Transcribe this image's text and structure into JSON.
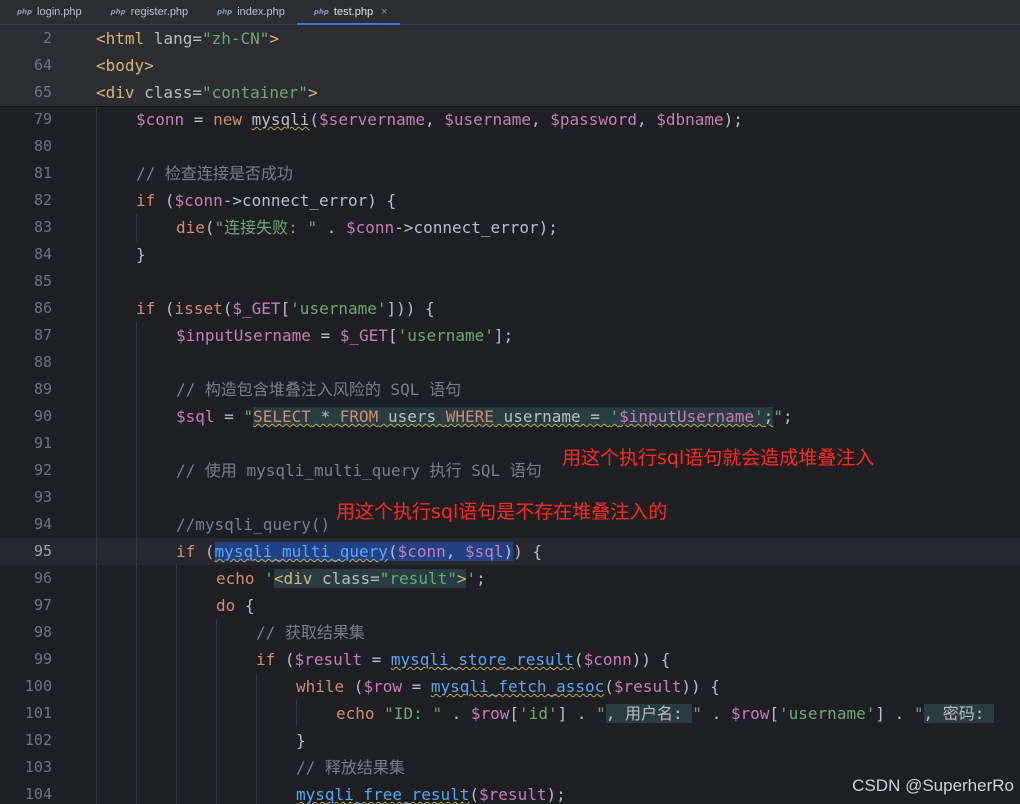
{
  "tabs": [
    {
      "icon": "php",
      "label": "login.php",
      "active": false
    },
    {
      "icon": "php",
      "label": "register.php",
      "active": false
    },
    {
      "icon": "php",
      "label": "index.php",
      "active": false
    },
    {
      "icon": "php",
      "label": "test.php",
      "active": true,
      "close": "×"
    }
  ],
  "sticky_lines": [
    {
      "num": "2",
      "html_tokens": [
        [
          "tag",
          "<html"
        ],
        [
          "attr",
          " lang="
        ],
        [
          "str",
          "\"zh-CN\""
        ],
        [
          "tag",
          ">"
        ]
      ]
    },
    {
      "num": "64",
      "html_tokens": [
        [
          "tag",
          "<body>"
        ]
      ]
    },
    {
      "num": "65",
      "html_tokens": [
        [
          "tag",
          "<div"
        ],
        [
          "attr",
          " class="
        ],
        [
          "str",
          "\"container\""
        ],
        [
          "tag",
          ">"
        ]
      ]
    }
  ],
  "code_lines": [
    {
      "num": "79",
      "indent": 1,
      "tokens": [
        [
          "var",
          "$conn"
        ],
        [
          "plain",
          " = "
        ],
        [
          "kw",
          "new "
        ],
        [
          "plain wav",
          "mysqli"
        ],
        [
          "plain",
          "("
        ],
        [
          "var",
          "$servername"
        ],
        [
          "plain",
          ", "
        ],
        [
          "var",
          "$username"
        ],
        [
          "plain",
          ", "
        ],
        [
          "var",
          "$password"
        ],
        [
          "plain",
          ", "
        ],
        [
          "var",
          "$dbname"
        ],
        [
          "plain",
          ");"
        ]
      ]
    },
    {
      "num": "80",
      "indent": 1,
      "tokens": []
    },
    {
      "num": "81",
      "indent": 1,
      "tokens": [
        [
          "cm",
          "// 检查连接是否成功"
        ]
      ]
    },
    {
      "num": "82",
      "indent": 1,
      "tokens": [
        [
          "kw",
          "if "
        ],
        [
          "plain",
          "("
        ],
        [
          "var",
          "$conn"
        ],
        [
          "plain",
          "->connect_error) {"
        ]
      ]
    },
    {
      "num": "83",
      "indent": 2,
      "tokens": [
        [
          "kw",
          "die"
        ],
        [
          "plain",
          "("
        ],
        [
          "str",
          "\"连接失败: \""
        ],
        [
          "plain",
          " . "
        ],
        [
          "var",
          "$conn"
        ],
        [
          "plain",
          "->connect_error);"
        ]
      ]
    },
    {
      "num": "84",
      "indent": 1,
      "tokens": [
        [
          "plain",
          "}"
        ]
      ]
    },
    {
      "num": "85",
      "indent": 1,
      "tokens": []
    },
    {
      "num": "86",
      "indent": 1,
      "tokens": [
        [
          "kw",
          "if "
        ],
        [
          "plain",
          "("
        ],
        [
          "kw",
          "isset"
        ],
        [
          "plain",
          "("
        ],
        [
          "var",
          "$_GET"
        ],
        [
          "plain",
          "["
        ],
        [
          "str",
          "'username'"
        ],
        [
          "plain",
          "])) {"
        ]
      ]
    },
    {
      "num": "87",
      "indent": 2,
      "tokens": [
        [
          "var",
          "$inputUsername"
        ],
        [
          "plain",
          " = "
        ],
        [
          "var",
          "$_GET"
        ],
        [
          "plain",
          "["
        ],
        [
          "str",
          "'username'"
        ],
        [
          "plain",
          "];"
        ]
      ]
    },
    {
      "num": "88",
      "indent": 2,
      "tokens": []
    },
    {
      "num": "89",
      "indent": 2,
      "tokens": [
        [
          "cm",
          "// 构造包含堆叠注入风险的 SQL 语句"
        ]
      ]
    },
    {
      "num": "90",
      "indent": 2,
      "tokens": [
        [
          "var",
          "$sql"
        ],
        [
          "plain",
          " = "
        ],
        [
          "str",
          "\""
        ],
        [
          "kw sqlbg wav",
          "SELECT"
        ],
        [
          "plain sqlbg wav",
          " * "
        ],
        [
          "kw sqlbg wav",
          "FROM"
        ],
        [
          "plain sqlbg wav",
          " users "
        ],
        [
          "kw sqlbg wav",
          "WHERE"
        ],
        [
          "plain sqlbg wav",
          " username = "
        ],
        [
          "str sqlbg wav",
          "'"
        ],
        [
          "var sqlbg wav",
          "$inputUsername"
        ],
        [
          "str sqlbg wav",
          "'"
        ],
        [
          "plain sqlbg wav",
          ";"
        ],
        [
          "str",
          "\""
        ],
        [
          "plain",
          ";"
        ]
      ]
    },
    {
      "num": "91",
      "indent": 2,
      "tokens": []
    },
    {
      "num": "92",
      "indent": 2,
      "tokens": [
        [
          "cm",
          "// 使用 mysqli_multi_query 执行 SQL 语句"
        ]
      ]
    },
    {
      "num": "93",
      "indent": 2,
      "tokens": []
    },
    {
      "num": "94",
      "indent": 2,
      "tokens": [
        [
          "cm",
          "//mysqli_query()"
        ]
      ]
    },
    {
      "num": "95",
      "indent": 2,
      "current": true,
      "tokens": [
        [
          "kw",
          "if "
        ],
        [
          "plain",
          "("
        ],
        [
          "fn sel wav",
          "mysqli_multi_query"
        ],
        [
          "plain sel",
          "("
        ],
        [
          "var sel",
          "$conn"
        ],
        [
          "plain sel",
          ", "
        ],
        [
          "var sel",
          "$sql"
        ],
        [
          "plain sel",
          ")"
        ],
        [
          "plain",
          ") {"
        ]
      ]
    },
    {
      "num": "96",
      "indent": 3,
      "tokens": [
        [
          "kw",
          "echo "
        ],
        [
          "str",
          "'"
        ],
        [
          "tag sqlbg",
          "<div"
        ],
        [
          "attr sqlbg",
          " class="
        ],
        [
          "str sqlbg",
          "\"result\""
        ],
        [
          "tag sqlbg",
          ">"
        ],
        [
          "str",
          "'"
        ],
        [
          "plain",
          ";"
        ]
      ]
    },
    {
      "num": "97",
      "indent": 3,
      "tokens": [
        [
          "kw",
          "do "
        ],
        [
          "plain",
          "{"
        ]
      ]
    },
    {
      "num": "98",
      "indent": 4,
      "tokens": [
        [
          "cm",
          "// 获取结果集"
        ]
      ]
    },
    {
      "num": "99",
      "indent": 4,
      "tokens": [
        [
          "kw",
          "if "
        ],
        [
          "plain",
          "("
        ],
        [
          "var",
          "$result"
        ],
        [
          "plain",
          " = "
        ],
        [
          "fn wav",
          "mysqli_store_result"
        ],
        [
          "plain",
          "("
        ],
        [
          "var",
          "$conn"
        ],
        [
          "plain",
          ")) {"
        ]
      ]
    },
    {
      "num": "100",
      "indent": 5,
      "tokens": [
        [
          "kw",
          "while "
        ],
        [
          "plain",
          "("
        ],
        [
          "var",
          "$row"
        ],
        [
          "plain",
          " = "
        ],
        [
          "fn wav",
          "mysqli_fetch_assoc"
        ],
        [
          "plain",
          "("
        ],
        [
          "var",
          "$result"
        ],
        [
          "plain",
          ")) {"
        ]
      ]
    },
    {
      "num": "101",
      "indent": 6,
      "tokens": [
        [
          "kw",
          "echo "
        ],
        [
          "str",
          "\"ID: \""
        ],
        [
          "plain",
          " . "
        ],
        [
          "var",
          "$row"
        ],
        [
          "plain",
          "["
        ],
        [
          "str",
          "'id'"
        ],
        [
          "plain",
          "] . "
        ],
        [
          "str",
          "\""
        ],
        [
          "plain sqlbg",
          ", 用户名: "
        ],
        [
          "str",
          "\""
        ],
        [
          "plain",
          " . "
        ],
        [
          "var",
          "$row"
        ],
        [
          "plain",
          "["
        ],
        [
          "str",
          "'username'"
        ],
        [
          "plain",
          "] . "
        ],
        [
          "str",
          "\""
        ],
        [
          "plain sqlbg",
          ", 密码: "
        ]
      ]
    },
    {
      "num": "102",
      "indent": 5,
      "tokens": [
        [
          "plain",
          "}"
        ]
      ]
    },
    {
      "num": "103",
      "indent": 5,
      "tokens": [
        [
          "cm",
          "// 释放结果集"
        ]
      ]
    },
    {
      "num": "104",
      "indent": 5,
      "tokens": [
        [
          "fn wav",
          "mysqli_free_result"
        ],
        [
          "plain",
          "("
        ],
        [
          "var",
          "$result"
        ],
        [
          "plain",
          ");"
        ]
      ]
    }
  ],
  "annotations": [
    {
      "line": "92",
      "text": "用这个执行sql语句就会造成堆叠注入"
    },
    {
      "line": "94",
      "text": "用这个执行sql语句是不存在堆叠注入的"
    }
  ],
  "watermark": "CSDN @SuperherRo",
  "colors": {
    "background": "#1e1f22",
    "keyword": "#cf8e6d",
    "string": "#6aab73",
    "variable": "#c77dbb",
    "function": "#56a8f5",
    "comment": "#7a7e85",
    "annotation": "#ff2a1a",
    "selection": "#214283"
  }
}
